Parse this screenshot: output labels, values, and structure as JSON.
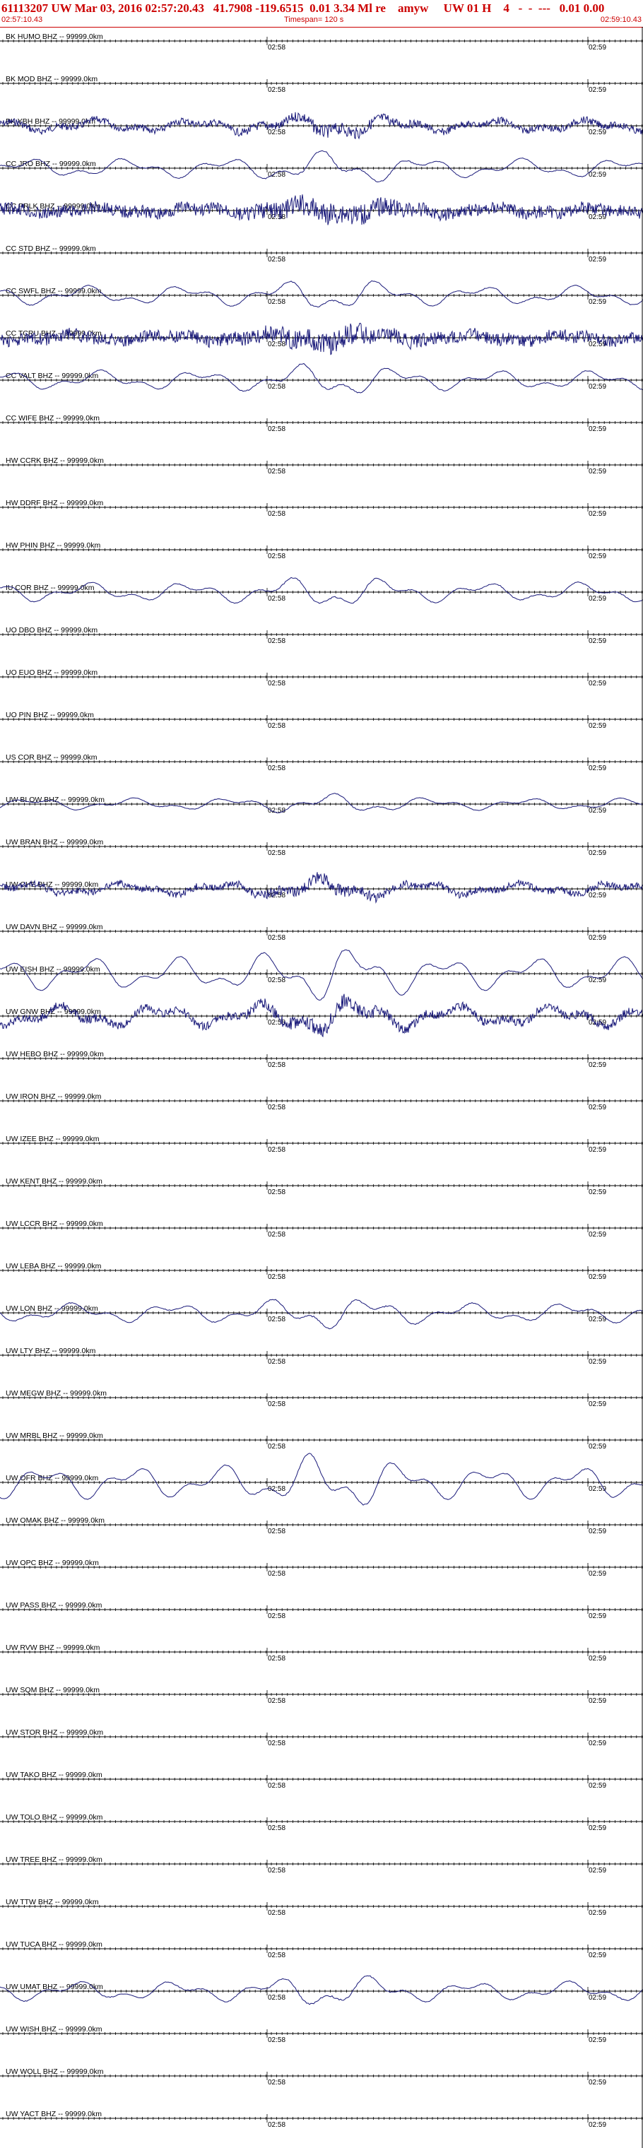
{
  "header": {
    "title": "61113207 UW Mar 03, 2016 02:57:20.43   41.7908 -119.6515  0.01 3.34 Ml re    amyw     UW 01 H    4   -  -  ---   0.01 0.00",
    "start_time": "02:57:10.43",
    "timespan": "Timespan= 120 s",
    "end_time": "02:59:10.43"
  },
  "minute_marks": [
    "02:58",
    "02:59"
  ],
  "colors": {
    "header": "#cc0000",
    "trace": "#1a1a7a",
    "axis": "#000000"
  },
  "stations": [
    {
      "label": "BK HUMO BHZ -- 99999.0km",
      "style": "flat"
    },
    {
      "label": "BK MOD BHZ -- 99999.0km",
      "style": "flat"
    },
    {
      "label": "BK YBH BHZ -- 99999.0km",
      "style": "noisy-mid"
    },
    {
      "label": "CC JRO BHZ -- 99999.0km",
      "style": "wave"
    },
    {
      "label": "CC PRLK BHZ -- 99999.0km",
      "style": "noisy-dense"
    },
    {
      "label": "CC STD BHZ -- 99999.0km",
      "style": "flat"
    },
    {
      "label": "CC SWFL BHZ -- 99999.0km",
      "style": "wave"
    },
    {
      "label": "CC TCRU BHZ -- 99999.0km",
      "style": "noisy-dense"
    },
    {
      "label": "CC VALT BHZ -- 99999.0km",
      "style": "wave"
    },
    {
      "label": "CC WIFE BHZ -- 99999.0km",
      "style": "flat"
    },
    {
      "label": "HW CCRK BHZ -- 99999.0km",
      "style": "flat"
    },
    {
      "label": "HW DDRF BHZ -- 99999.0km",
      "style": "flat"
    },
    {
      "label": "HW PHIN BHZ -- 99999.0km",
      "style": "flat"
    },
    {
      "label": "IU COR BHZ -- 99999.0km",
      "style": "wave"
    },
    {
      "label": "UO DBO BHZ -- 99999.0km",
      "style": "flat"
    },
    {
      "label": "UO EUO BHZ -- 99999.0km",
      "style": "flat"
    },
    {
      "label": "UO PIN BHZ -- 99999.0km",
      "style": "flat"
    },
    {
      "label": "US COR BHZ -- 99999.0km",
      "style": "flat"
    },
    {
      "label": "UW BLOW BHZ -- 99999.0km",
      "style": "wave-small"
    },
    {
      "label": "UW BRAN BHZ -- 99999.0km",
      "style": "flat"
    },
    {
      "label": "UW CHE BHZ -- 99999.0km",
      "style": "noisy-mid"
    },
    {
      "label": "UW DAVN BHZ -- 99999.0km",
      "style": "flat"
    },
    {
      "label": "UW EISH BHZ -- 99999.0km",
      "style": "wave-big"
    },
    {
      "label": "UW GNW BHZ -- 99999.0km",
      "style": "noisy-wave"
    },
    {
      "label": "UW HEBO BHZ -- 99999.0km",
      "style": "flat"
    },
    {
      "label": "UW IRON BHZ -- 99999.0km",
      "style": "flat"
    },
    {
      "label": "UW IZEE BHZ -- 99999.0km",
      "style": "flat"
    },
    {
      "label": "UW KENT BHZ -- 99999.0km",
      "style": "flat"
    },
    {
      "label": "UW LCCR BHZ -- 99999.0km",
      "style": "flat"
    },
    {
      "label": "UW LEBA BHZ -- 99999.0km",
      "style": "flat"
    },
    {
      "label": "UW LON BHZ -- 99999.0km",
      "style": "wave"
    },
    {
      "label": "UW LTY BHZ -- 99999.0km",
      "style": "flat"
    },
    {
      "label": "UW MEGW BHZ -- 99999.0km",
      "style": "flat"
    },
    {
      "label": "UW MRBL BHZ -- 99999.0km",
      "style": "flat"
    },
    {
      "label": "UW OFR BHZ -- 99999.0km",
      "style": "wave-big"
    },
    {
      "label": "UW OMAK BHZ -- 99999.0km",
      "style": "flat"
    },
    {
      "label": "UW OPC BHZ -- 99999.0km",
      "style": "flat"
    },
    {
      "label": "UW PASS BHZ -- 99999.0km",
      "style": "flat"
    },
    {
      "label": "UW RVW BHZ -- 99999.0km",
      "style": "flat"
    },
    {
      "label": "UW SQM BHZ -- 99999.0km",
      "style": "flat"
    },
    {
      "label": "UW STOR BHZ -- 99999.0km",
      "style": "flat"
    },
    {
      "label": "UW TAKO BHZ -- 99999.0km",
      "style": "flat"
    },
    {
      "label": "UW TOLO BHZ -- 99999.0km",
      "style": "flat"
    },
    {
      "label": "UW TREE BHZ -- 99999.0km",
      "style": "flat"
    },
    {
      "label": "UW TTW BHZ -- 99999.0km",
      "style": "flat"
    },
    {
      "label": "UW TUCA BHZ -- 99999.0km",
      "style": "flat"
    },
    {
      "label": "UW UMAT BHZ -- 99999.0km",
      "style": "wave"
    },
    {
      "label": "UW WISH BHZ -- 99999.0km",
      "style": "flat"
    },
    {
      "label": "UW WOLL BHZ -- 99999.0km",
      "style": "flat"
    },
    {
      "label": "UW YACT BHZ -- 99999.0km",
      "style": "flat"
    }
  ]
}
